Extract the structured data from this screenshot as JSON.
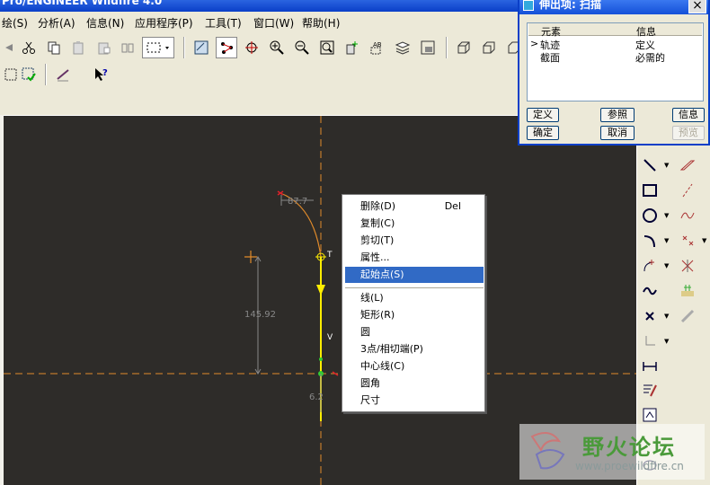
{
  "window": {
    "title": "Pro/ENGINEER Wildfire 4.0"
  },
  "menu": [
    {
      "label": "绘(S)"
    },
    {
      "label": "分析(A)"
    },
    {
      "label": "信息(N)"
    },
    {
      "label": "应用程序(P)"
    },
    {
      "label": "工具(T)"
    },
    {
      "label": "窗口(W)"
    },
    {
      "label": "帮助(H)"
    }
  ],
  "toolbar": {
    "icons": [
      "undo-icon",
      "cut-icon",
      "copy-icon",
      "paste-icon",
      "paste-special-icon",
      "regenerate-icon",
      "selection-filter-icon",
      "repaint-icon",
      "spin-center-icon",
      "orient-icon",
      "zoom-in-icon",
      "zoom-out-icon",
      "refit-icon",
      "reorient-icon",
      "saved-views-icon",
      "layers-icon",
      "view-manager-icon",
      "datum-plane-icon",
      "datum-axis-icon",
      "datum-point-icon",
      "datum-csys-icon"
    ],
    "row2_icons": [
      "sketch-setup-icon",
      "sketch-check-icon",
      "datum-display-icon",
      "whats-this-icon"
    ]
  },
  "canvas": {
    "dim_top": "87.7",
    "dim_vertical": "145.92",
    "dim_bottom": "6.2",
    "label_T": "T",
    "label_V": "V"
  },
  "context_menu": {
    "items": [
      {
        "label": "删除(D)",
        "accel": "Del"
      },
      {
        "label": "复制(C)",
        "accel": ""
      },
      {
        "label": "剪切(T)",
        "accel": ""
      },
      {
        "label": "属性...",
        "accel": ""
      },
      {
        "label": "起始点(S)",
        "accel": "",
        "selected": true
      },
      {
        "label": "线(L)",
        "accel": ""
      },
      {
        "label": "矩形(R)",
        "accel": ""
      },
      {
        "label": "圆",
        "accel": ""
      },
      {
        "label": "3点/相切端(P)",
        "accel": ""
      },
      {
        "label": "中心线(C)",
        "accel": ""
      },
      {
        "label": "圆角",
        "accel": ""
      },
      {
        "label": "尺寸",
        "accel": ""
      }
    ]
  },
  "dialog": {
    "title": "伸出项: 扫描",
    "close": "×",
    "columns": [
      "元素",
      "信息"
    ],
    "rows": [
      {
        "marker": ">",
        "element": "轨迹",
        "info": "定义"
      },
      {
        "marker": "",
        "element": "截面",
        "info": "必需的"
      }
    ],
    "buttons": {
      "define": "定义",
      "refs": "参照",
      "info": "信息",
      "ok": "确定",
      "cancel": "取消",
      "preview": "预览"
    }
  },
  "watermark": {
    "text": "野火论坛",
    "url": "www.proewildfire.cn"
  },
  "colors": {
    "canvas_bg": "#2e2c29",
    "centerline": "#e08a2a",
    "trajectory": "#ffee00",
    "selection": "#316ac5"
  }
}
